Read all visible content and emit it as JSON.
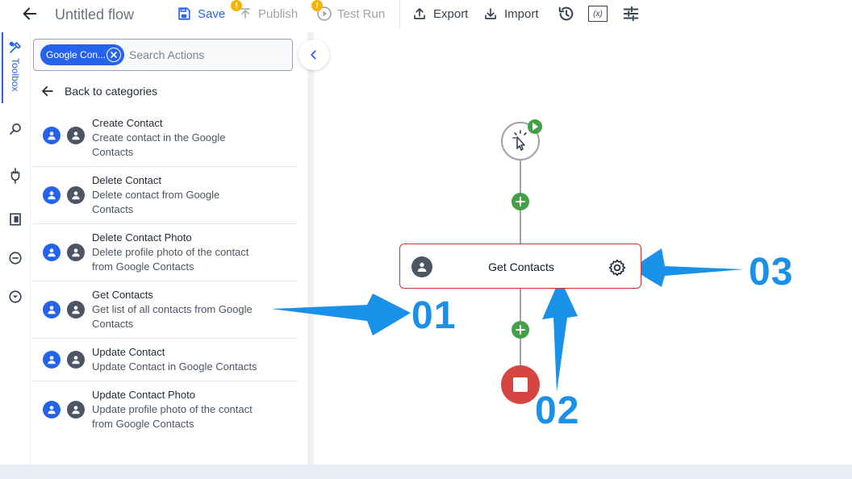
{
  "header": {
    "title": "Untitled flow",
    "save_label": "Save",
    "publish_label": "Publish",
    "publish_badge": "!",
    "test_run_label": "Test Run",
    "test_run_badge": "!",
    "export_label": "Export",
    "import_label": "Import",
    "vars_glyph": "(x)"
  },
  "rail": {
    "toolbox_label": "Toolbox"
  },
  "panel": {
    "filter_chip": "Google Con...",
    "search_placeholder": "Search Actions",
    "back_label": "Back to categories",
    "actions": [
      {
        "title": "Create Contact",
        "desc": "Create contact in the Google Contacts"
      },
      {
        "title": "Delete Contact",
        "desc": "Delete contact from Google Contacts"
      },
      {
        "title": "Delete Contact Photo",
        "desc": "Delete profile photo of the contact from Google Contacts"
      },
      {
        "title": "Get Contacts",
        "desc": "Get list of all contacts from Google Contacts"
      },
      {
        "title": "Update Contact",
        "desc": "Update Contact in Google Contacts"
      },
      {
        "title": "Update Contact Photo",
        "desc": "Update profile photo of the contact from Google Contacts"
      }
    ]
  },
  "canvas": {
    "step_title": "Get Contacts"
  },
  "annotations": {
    "label_1": "01",
    "label_2": "02",
    "label_3": "03"
  },
  "colors": {
    "accent": "#2563eb",
    "callout": "#1a91e8",
    "add_node": "#43a047",
    "stop_node": "#d64541",
    "step_border": "#c0392b"
  }
}
